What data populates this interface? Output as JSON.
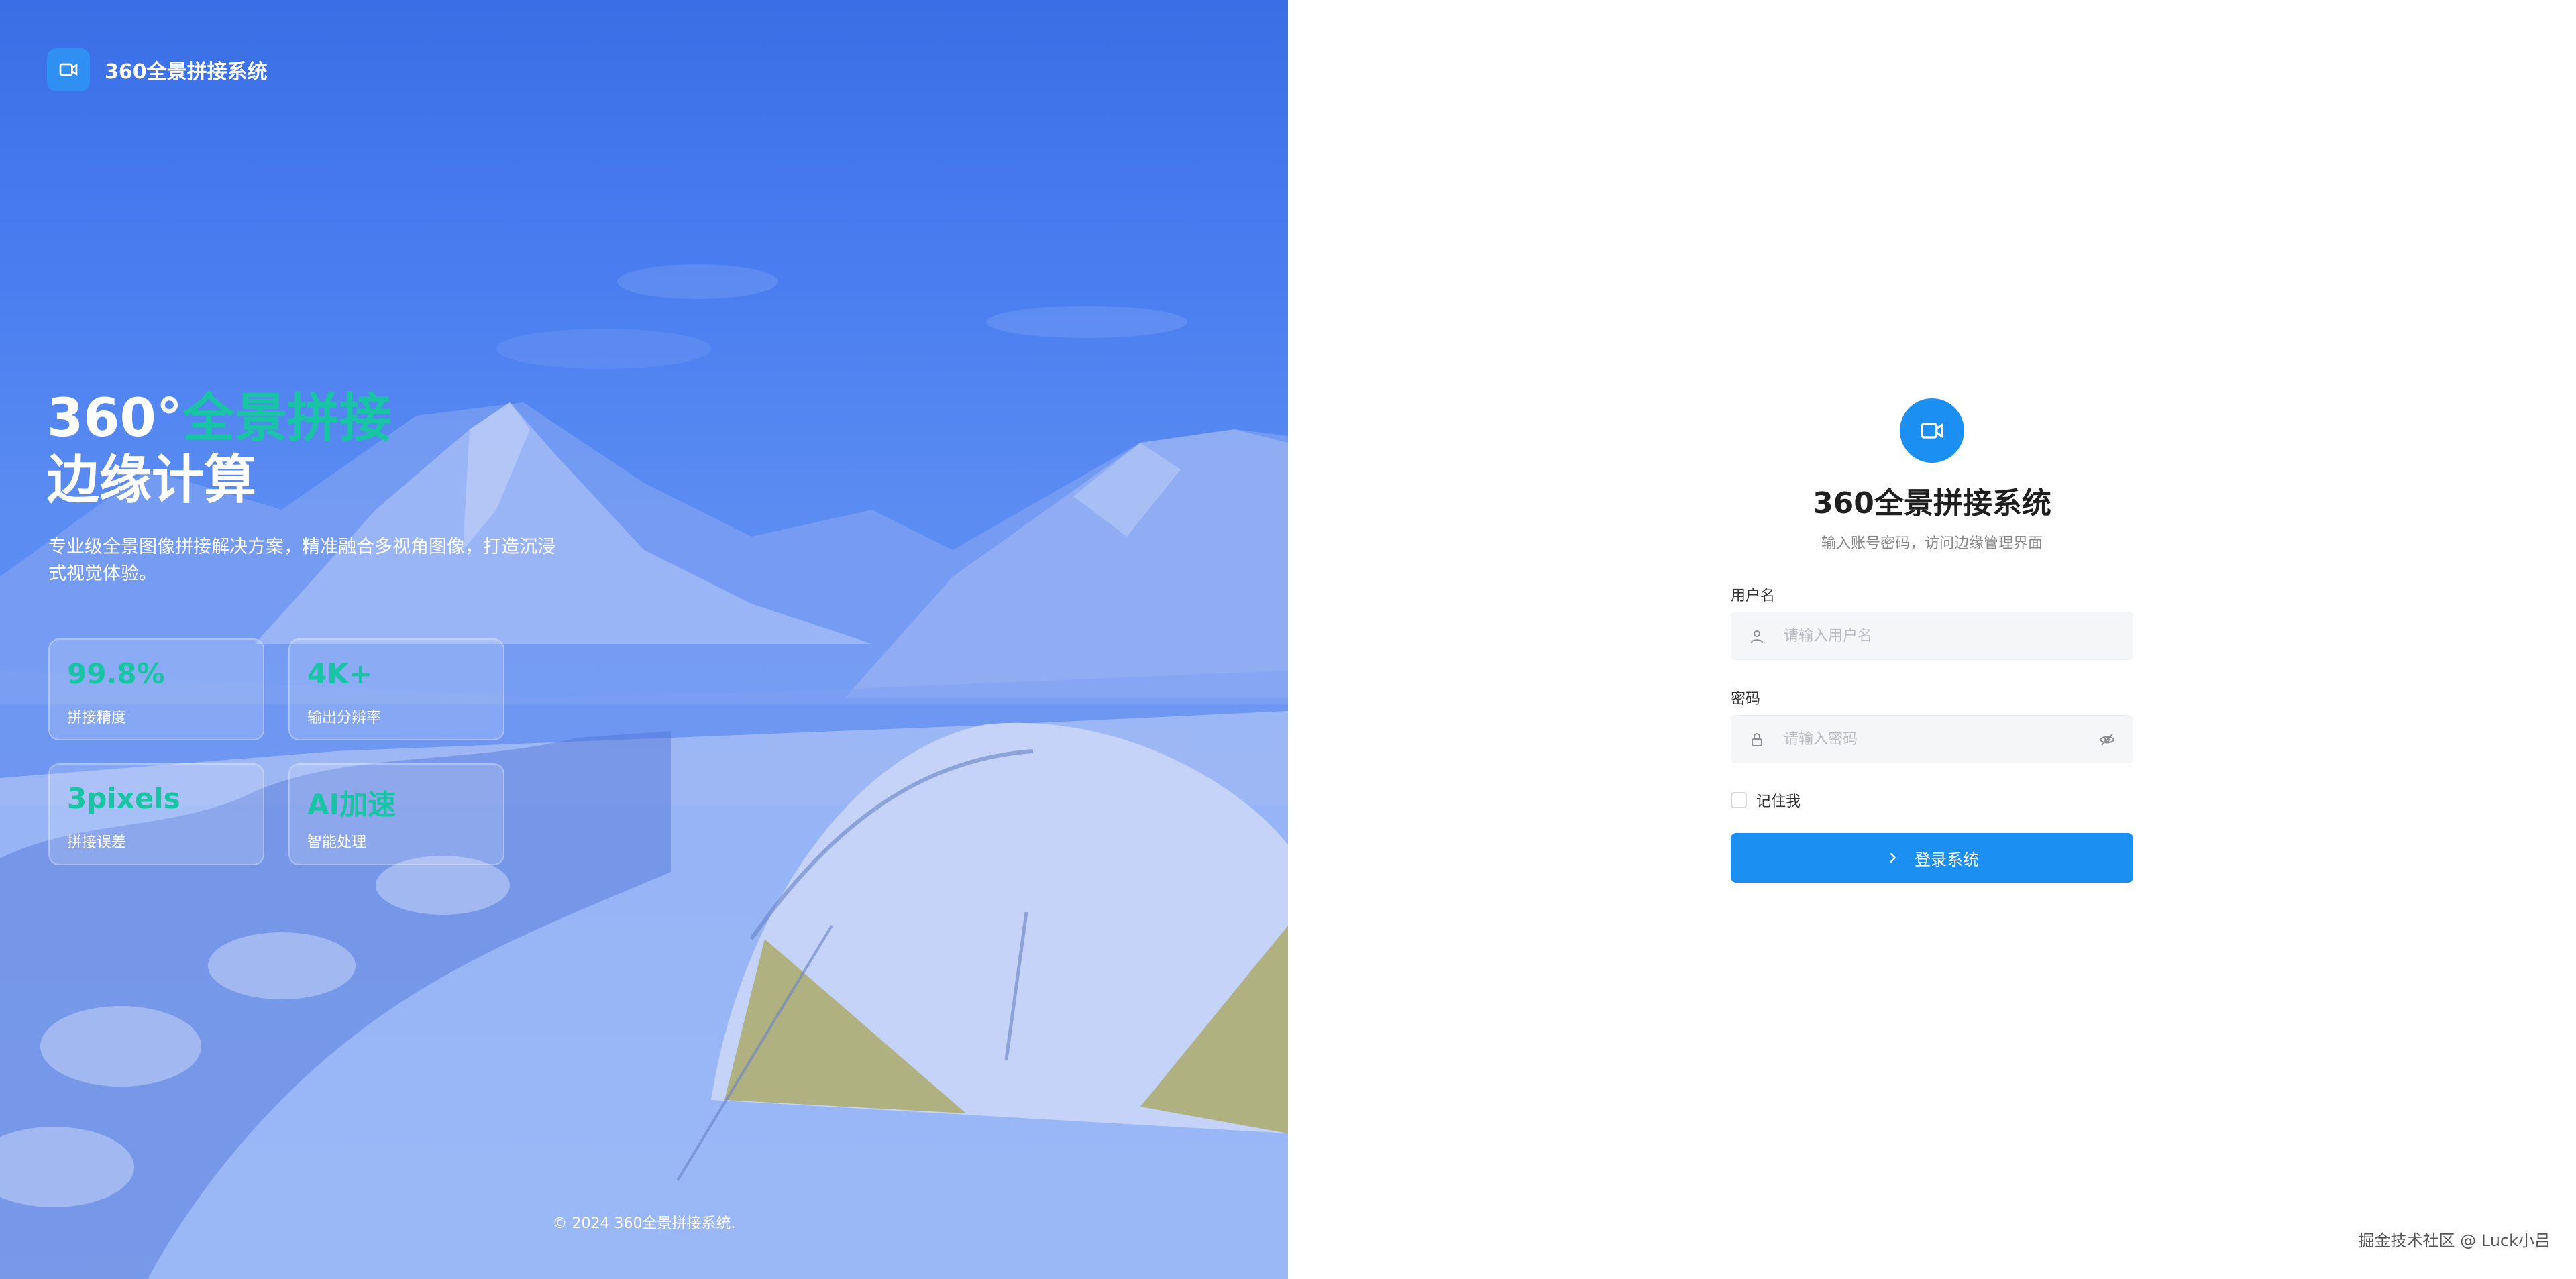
{
  "brand": {
    "title": "360全景拼接系统",
    "logo_icon": "video-camera-icon"
  },
  "hero": {
    "headline_prefix": "360°",
    "headline_accent": "全景拼接",
    "headline_line2": "边缘计算",
    "description": "专业级全景图像拼接解决方案，精准融合多视角图像，打造沉浸式视觉体验。",
    "stats": [
      {
        "value": "99.8%",
        "label": "拼接精度"
      },
      {
        "value": "4K+",
        "label": "输出分辨率"
      },
      {
        "value": "3pixels",
        "label": "拼接误差"
      },
      {
        "value": "AI加速",
        "label": "智能处理"
      }
    ],
    "footer": "© 2024 360全景拼接系统."
  },
  "login": {
    "icon": "video-camera-icon",
    "title": "360全景拼接系统",
    "subtitle": "输入账号密码，访问边缘管理界面",
    "username_label": "用户名",
    "username_placeholder": "请输入用户名",
    "password_label": "密码",
    "password_placeholder": "请输入密码",
    "remember_label": "记住我",
    "submit_label": "登录系统"
  },
  "watermark": "掘金技术社区 @ Luck小吕",
  "colors": {
    "hero_overlay": "#4a7ef0",
    "accent_green": "#17c4a4",
    "primary_blue": "#1b8ff2"
  }
}
